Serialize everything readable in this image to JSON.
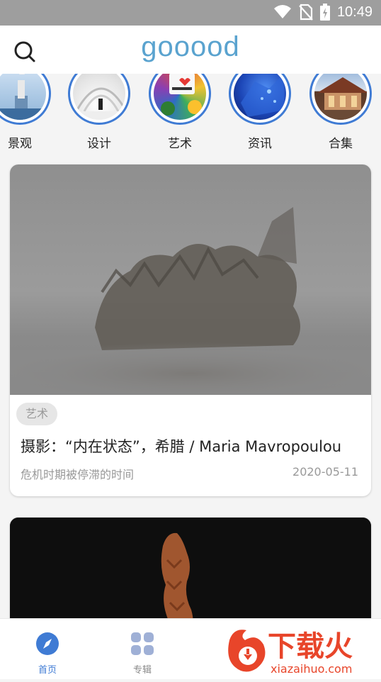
{
  "status_bar": {
    "time": "10:49",
    "icons": [
      "wifi-icon",
      "no-sim-icon",
      "battery-charging-icon"
    ]
  },
  "app_bar": {
    "logo_text": "gooood",
    "search_icon": "search-icon"
  },
  "categories": [
    {
      "label": "景观"
    },
    {
      "label": "设计"
    },
    {
      "label": "艺术"
    },
    {
      "label": "资讯"
    },
    {
      "label": "合集"
    }
  ],
  "feed": [
    {
      "tag": "艺术",
      "title": "摄影：“内在状态”，希腊 / Maria Mavropoulou",
      "subtitle": "危机时期被停滞的时间",
      "date": "2020-05-11"
    }
  ],
  "bottom_nav": {
    "items": [
      {
        "label": "首页",
        "icon": "compass-icon",
        "active": true
      },
      {
        "label": "专辑",
        "icon": "grid-icon",
        "active": false
      }
    ]
  },
  "watermark": {
    "brand": "下载火",
    "url": "xiazaihuo.com"
  },
  "colors": {
    "accent": "#3f7bd4",
    "logo": "#5aa3cf",
    "statusbar": "#9e9e9e",
    "watermark": "#e8452a"
  }
}
